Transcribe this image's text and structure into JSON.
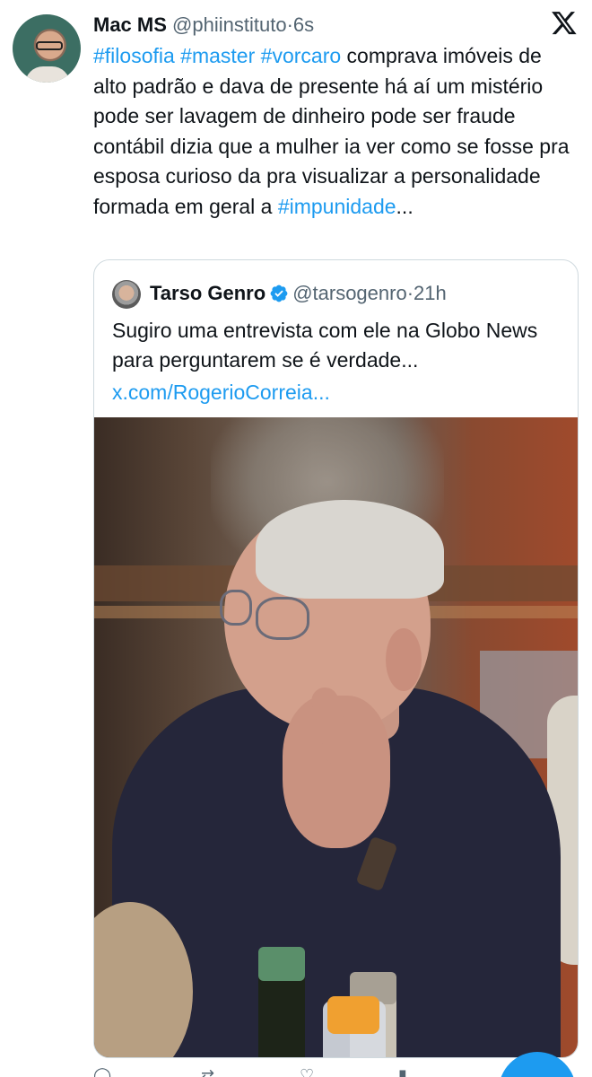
{
  "author": {
    "name": "Mac MS",
    "handle": "@phiinstituto",
    "dot": "·",
    "time": "6s",
    "avatar_icon": "profile-photo"
  },
  "platform_icon": "x-logo",
  "tweet": {
    "tags": [
      "#filosofia",
      "#master",
      "#vorcaro"
    ],
    "text": " comprava imóveis de alto padrão e dava de presente há aí um mistério pode ser lavagem de dinheiro pode ser fraude contábil dizia que a mulher ia ver como se fosse pra esposa curioso da pra visualizar a personalidade formada em geral a ",
    "last_tag": "#impunidade",
    "ellipsis": "..."
  },
  "quote": {
    "name": "Tarso Genro",
    "verified_icon": "verified-badge-icon",
    "handle": "@tarsogenro",
    "dot": "·",
    "time": "21h",
    "text": "Sugiro uma entrevista com ele na Globo News para perguntarem se é verdade...",
    "link": "x.com/RogerioCorreia..."
  },
  "colors": {
    "accent": "#1d9bf0",
    "text": "#0f1419",
    "muted": "#536471",
    "border": "#cfd9de"
  }
}
